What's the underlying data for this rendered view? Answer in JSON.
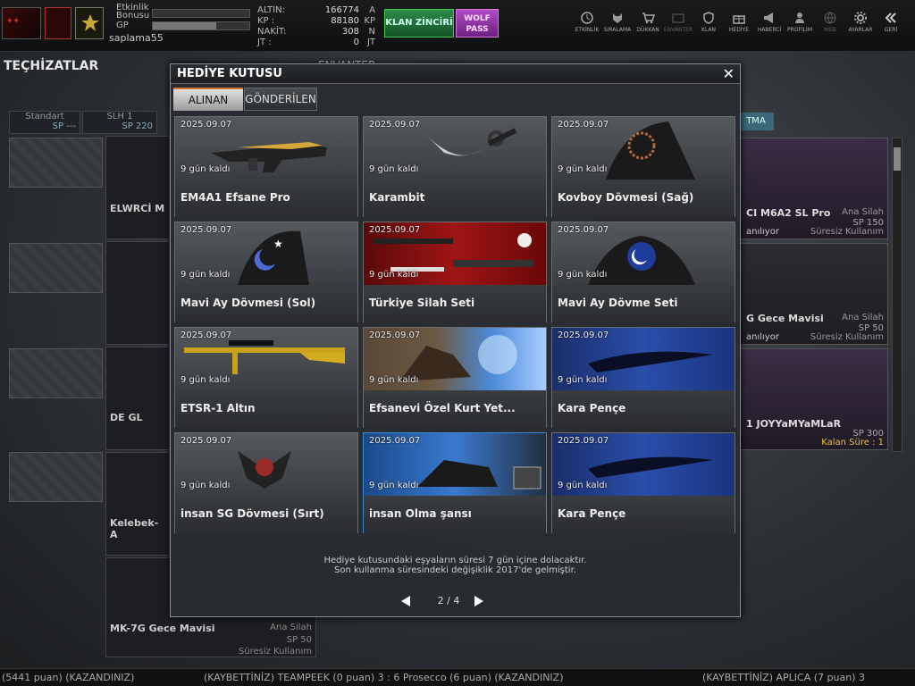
{
  "topbar": {
    "bonus_label_1": "Etkinlik",
    "bonus_label_2": "Bonusu",
    "gp_label": "GP",
    "username": "saplama55",
    "currency": [
      {
        "key": "ALTIN:",
        "value": "166774",
        "unit": "A"
      },
      {
        "key": "KP  :",
        "value": "88180",
        "unit": "KP"
      },
      {
        "key": "NAKİT:",
        "value": "308",
        "unit": "N"
      },
      {
        "key": "JT  :",
        "value": "0",
        "unit": "JT"
      }
    ],
    "klan_button": "KLAN ZİNCİRİ",
    "wolf_button_1": "WOLF",
    "wolf_button_2": "PASS",
    "nav": [
      "ETKİNLİK",
      "SIRALAMA",
      "DÜKKAN",
      "ENVANTER",
      "KLAN",
      "HEDİYE",
      "HABERCİ",
      "PROFİLİM",
      "WEB",
      "AYARLAR",
      "GERİ"
    ]
  },
  "background": {
    "page_title": "TEÇHİZATLAR",
    "inventory_title": "ENVANTER",
    "tabs": [
      {
        "title": "Standart",
        "sub": "SP ---"
      },
      {
        "title": "SLH 1",
        "sub": "SP 220"
      }
    ],
    "left_items": [
      {
        "name": "ELWRCİ M"
      },
      {
        "name": "DE GL"
      },
      {
        "name": "Kelebek- A"
      },
      {
        "name": "MK-7G Gece Mavisi",
        "tag": "Ana Silah",
        "sp": "SP 50",
        "status": "Süresiz Kullanım"
      }
    ],
    "right_tab": "TMA",
    "right_items": [
      {
        "name": "CI M6A2 SL Pro",
        "tag": "Ana Silah",
        "sp": "SP 150",
        "status": "anılıyor",
        "status2": "Süresiz Kullanım"
      },
      {
        "name": "G Gece Mavisi",
        "tag": "Ana Silah",
        "sp": "SP 50",
        "status": "anılıyor",
        "status2": "Süresiz Kullanım"
      },
      {
        "name": "1 JOYYaMYaMLaR",
        "tag": "",
        "sp": "SP 300",
        "status": "",
        "status2": "Kalan Süre : 1"
      }
    ]
  },
  "modal": {
    "title": "HEDİYE KUTUSU",
    "tab_received": "ALINAN",
    "tab_sent": "GÖNDERİLEN",
    "items": [
      {
        "date": "2025.09.07",
        "left": "9 gün kaldı",
        "name": "EM4A1 Efsane Pro",
        "icon": "rifle-gold-icon"
      },
      {
        "date": "2025.09.07",
        "left": "9 gün kaldı",
        "name": "Karambit",
        "icon": "karambit-knife-icon"
      },
      {
        "date": "2025.09.07",
        "left": "9 gün kaldı",
        "name": "Kovboy Dövmesi (Sağ)",
        "icon": "tattoo-right-icon"
      },
      {
        "date": "2025.09.07",
        "left": "9 gün kaldı",
        "name": "Mavi Ay Dövmesi (Sol)",
        "icon": "moon-tattoo-left-icon"
      },
      {
        "date": "2025.09.07",
        "left": "9 gün kaldı",
        "name": "Türkiye Silah Seti",
        "icon": "turkey-weapon-set-icon"
      },
      {
        "date": "2025.09.07",
        "left": "9 gün kaldı",
        "name": "Mavi Ay Dövme Seti",
        "icon": "moon-tattoo-set-icon"
      },
      {
        "date": "2025.09.07",
        "left": "9 gün kaldı",
        "name": "ETSR-1 Altın",
        "icon": "sniper-gold-icon"
      },
      {
        "date": "2025.09.07",
        "left": "9 gün kaldı",
        "name": "Efsanevi Özel Kurt Yet...",
        "icon": "wolf-skill-icon"
      },
      {
        "date": "2025.09.07",
        "left": "9 gün kaldı",
        "name": "Kara Pençe",
        "icon": "claw-spray-icon"
      },
      {
        "date": "2025.09.07",
        "left": "9 gün kaldı",
        "name": "insan SG Dövmesi (Sırt)",
        "icon": "back-tattoo-icon"
      },
      {
        "date": "2025.09.07",
        "left": "9 gün kaldı",
        "name": "insan Olma şansı",
        "icon": "human-chance-icon"
      },
      {
        "date": "2025.09.07",
        "left": "9 gün kaldı",
        "name": "Kara Pençe",
        "icon": "claw-spray-icon"
      }
    ],
    "notice_1": "Hediye kutusundaki eşyaların süresi 7 gün içine dolacaktır.",
    "notice_2": "Son kullanma süresindeki değişiklik 2017'de gelmiştir.",
    "page": "2 / 4"
  },
  "ticker": {
    "part_1": "(5441 puan) (KAZANDINIZ)",
    "part_2": "(KAYBETTİNİZ) TEAMPEEK (0 puan) 3 : 6 Prosecco (6 puan) (KAZANDINIZ)",
    "part_3": "(KAYBETTİNİZ) APLICA (7 puan) 3"
  },
  "colors": {
    "accent_tab": "#d8742a",
    "klan_green": "#2c8a4a",
    "wolf_purple": "#b04ac8"
  }
}
